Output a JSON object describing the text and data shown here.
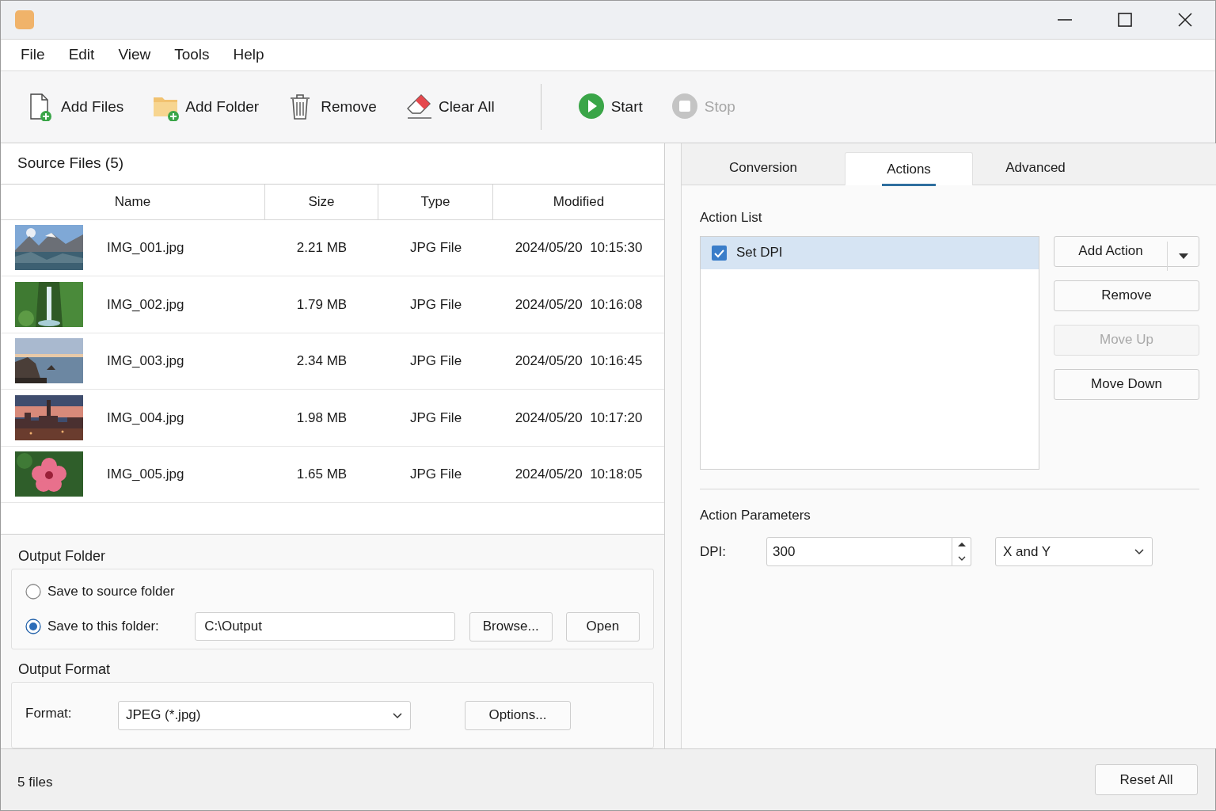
{
  "menu": [
    "File",
    "Edit",
    "View",
    "Tools",
    "Help"
  ],
  "toolbar": [
    {
      "kind": "add_files",
      "label": "Add Files",
      "disabled": false
    },
    {
      "kind": "add_folder",
      "label": "Add Folder",
      "disabled": false
    },
    {
      "kind": "remove",
      "label": "Remove",
      "disabled": false
    },
    {
      "kind": "clear",
      "label": "Clear All",
      "disabled": false
    },
    {
      "kind": "separator"
    },
    {
      "kind": "start",
      "label": "Start",
      "disabled": false
    },
    {
      "kind": "stop",
      "label": "Stop",
      "disabled": true
    }
  ],
  "source_files": {
    "title": "Source Files (5)",
    "columns": [
      "Name",
      "Size",
      "Type",
      "Modified"
    ],
    "rows": [
      {
        "name": "IMG_001.jpg",
        "size": "2.21 MB",
        "type": "JPG File",
        "modified": "2024/05/20  10:15:30"
      },
      {
        "name": "IMG_002.jpg",
        "size": "1.79 MB",
        "type": "JPG File",
        "modified": "2024/05/20  10:16:08"
      },
      {
        "name": "IMG_003.jpg",
        "size": "2.34 MB",
        "type": "JPG File",
        "modified": "2024/05/20  10:16:45"
      },
      {
        "name": "IMG_004.jpg",
        "size": "1.98 MB",
        "type": "JPG File",
        "modified": "2024/05/20  10:17:20"
      },
      {
        "name": "IMG_005.jpg",
        "size": "1.65 MB",
        "type": "JPG File",
        "modified": "2024/05/20  10:18:05"
      }
    ]
  },
  "output_folder": {
    "title": "Output Folder",
    "options": [
      {
        "label": "Save to source folder",
        "selected": false
      },
      {
        "label": "Save to this folder:",
        "selected": true
      }
    ],
    "path": "C:\\Output",
    "buttons": [
      "Browse...",
      "Open"
    ]
  },
  "output_format": {
    "title": "Output Format",
    "label": "Format:",
    "value": "JPEG (*.jpg)",
    "button": "Options..."
  },
  "tabs": [
    {
      "label": "Conversion",
      "selected": false
    },
    {
      "label": "Actions",
      "selected": true
    },
    {
      "label": "Advanced",
      "selected": false
    }
  ],
  "action_list": {
    "title": "Action List",
    "items": [
      {
        "label": "Set DPI",
        "checked": true,
        "selected": true
      }
    ],
    "buttons": [
      {
        "label": "Add Action",
        "kind": "split",
        "disabled": false
      },
      {
        "label": "Remove",
        "kind": "plain",
        "disabled": false
      },
      {
        "label": "Move Up",
        "kind": "plain",
        "disabled": true
      },
      {
        "label": "Move Down",
        "kind": "plain",
        "disabled": false
      }
    ]
  },
  "action_parameters": {
    "title": "Action Parameters",
    "label": "DPI:",
    "value": "300",
    "axis": "X and Y"
  },
  "status_bar": {
    "text": "5 files",
    "button": "Reset All"
  }
}
